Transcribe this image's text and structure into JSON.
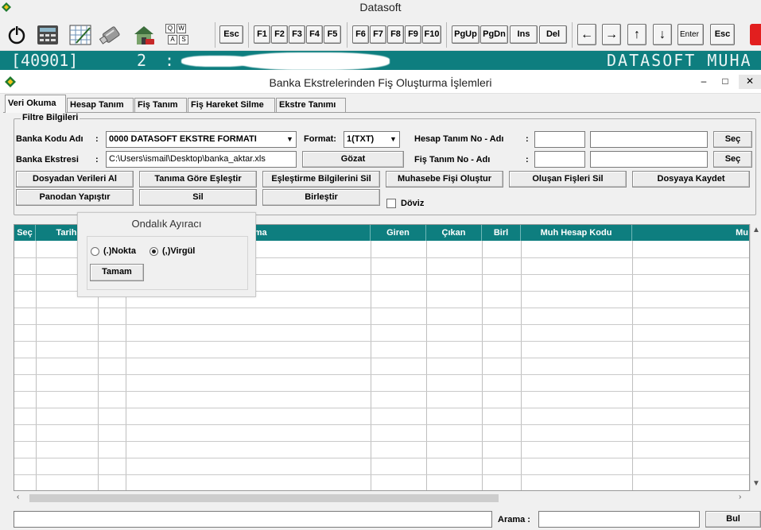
{
  "app": {
    "title": "Datasoft"
  },
  "toolbar": {
    "icons": [
      "power-icon",
      "calculator-icon",
      "spreadsheet-icon",
      "usb-drive-icon",
      "house-icon",
      "keyboard-icon"
    ],
    "keyboard_keys": [
      "Q",
      "W",
      "A",
      "S"
    ],
    "esc_label": "Esc",
    "f_keys": [
      "F1",
      "F2",
      "F3",
      "F4",
      "F5"
    ],
    "f_keys2": [
      "F6",
      "F7",
      "F8",
      "F9",
      "F10"
    ],
    "nav_keys": [
      "PgUp",
      "PgDn",
      "Ins",
      "Del"
    ],
    "arrow_left": "←",
    "arrow_right": "→",
    "arrow_up": "↑",
    "arrow_down": "↓",
    "enter_label": "Enter",
    "esc2_label": "Esc"
  },
  "status": {
    "code": "[40901]",
    "number": "2",
    "colon": ":",
    "brand": "DATASOFT MUHA"
  },
  "window": {
    "title": "Banka Ekstrelerinden Fiş Oluşturma İşlemleri",
    "minimize": "–",
    "maximize": "□",
    "close": "✕"
  },
  "tabs": [
    "Veri Okuma",
    "Hesap Tanım",
    "Fiş Tanım",
    "Fiş Hareket Silme",
    "Ekstre Tanımı"
  ],
  "filter": {
    "legend": "Filtre Bilgileri",
    "bank_code_label": "Banka Kodu Adı",
    "bank_code_value": "0000  DATASOFT EKSTRE FORMATI",
    "format_label": "Format:",
    "format_value": "1(TXT)",
    "hesap_label": "Hesap Tanım No - Adı",
    "fis_label": "Fiş Tanım No - Adı",
    "colon": ":",
    "ekstre_label": "Banka Ekstresi",
    "ekstre_value": "C:\\Users\\ismail\\Desktop\\banka_aktar.xls",
    "gozat": "Gözat",
    "sec": "Seç",
    "doviz_label": "Döviz"
  },
  "buttons": {
    "row1": [
      "Dosyadan Verileri Al",
      "Tanıma Göre Eşleştir",
      "Eşleştirme Bilgilerini Sil",
      "Muhasebe Fişi Oluştur",
      "Oluşan Fişleri Sil",
      "Dosyaya Kaydet"
    ],
    "row2": [
      "Panodan Yapıştır",
      "Sil",
      "Birleştir"
    ]
  },
  "grid": {
    "columns": [
      "Seç",
      "Tarih",
      "",
      "Açıklama",
      "Giren",
      "Çıkan",
      "Birl",
      "Muh Hesap Kodu",
      "Mu"
    ]
  },
  "popup": {
    "title": "Ondalık Ayıracı",
    "option_nokta": "(.)Nokta",
    "option_virgul": "(,)Virgül",
    "selected": "virgul",
    "ok": "Tamam"
  },
  "footer": {
    "search_label": "Arama :",
    "search_value": "",
    "find_button": "Bul"
  }
}
